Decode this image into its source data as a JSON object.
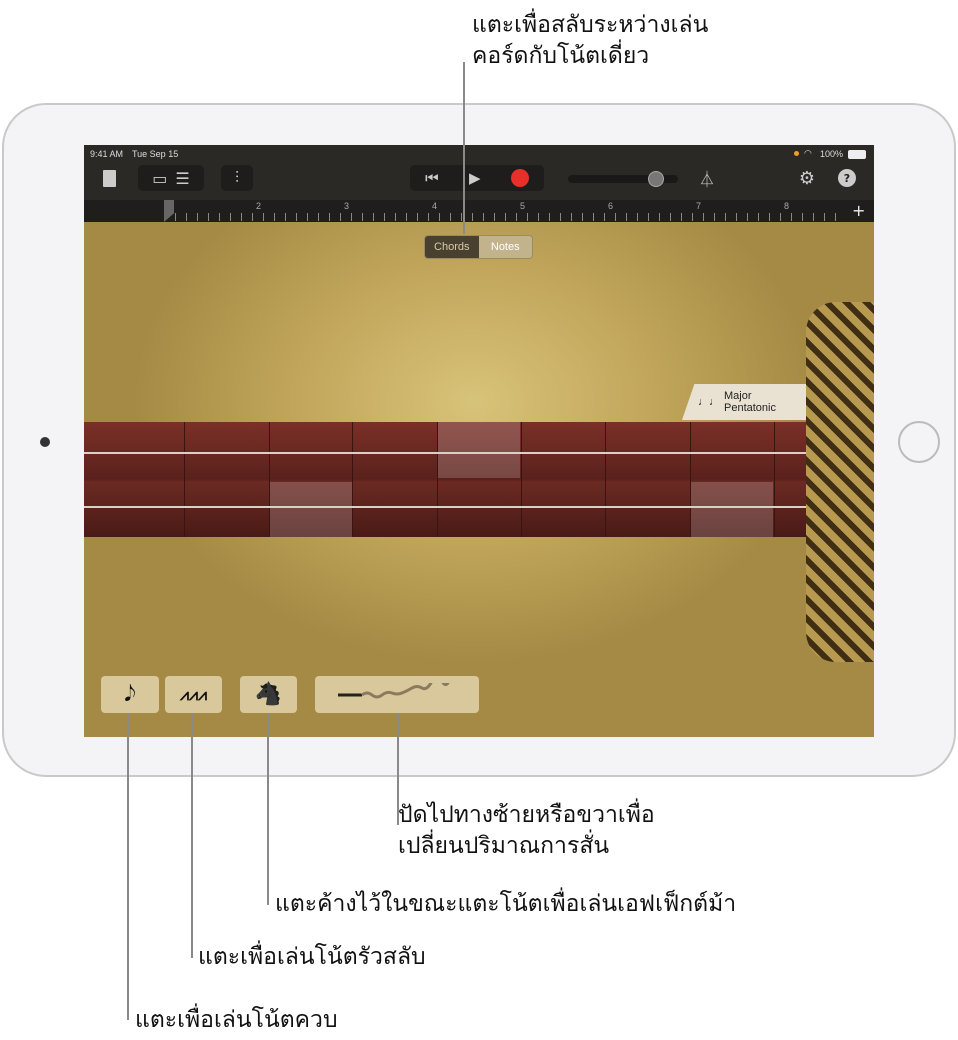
{
  "callouts": {
    "top": [
      "แตะเพื่อสลับระหว่างเล่น",
      "คอร์ดกับโน้ตเดี่ยว"
    ],
    "vibrato": [
      "ปัดไปทางซ้ายหรือขวาเพื่อ",
      "เปลี่ยนปริมาณการสั่น"
    ],
    "horse": "แตะค้างไว้ในขณะแตะโน้ตเพื่อเล่นเอฟเฟ็กต์ม้า",
    "tremolo": "แตะเพื่อเล่นโน้ตรัวสลับ",
    "double": "แตะเพื่อเล่นโน้ตควบ"
  },
  "status": {
    "time": "9:41 AM",
    "date": "Tue Sep 15",
    "battery": "100%"
  },
  "ruler": {
    "bars": [
      "1",
      "2",
      "3",
      "4",
      "5",
      "6",
      "7",
      "8"
    ],
    "add": "+"
  },
  "toggle": {
    "chords": "Chords",
    "notes": "Notes",
    "selected": "Notes"
  },
  "scale": {
    "icon": "♩♩",
    "label": "Major Pentatonic"
  },
  "controls": {
    "double_icon": "𝅘𝅥𝅮",
    "tremolo_icon": "⩘⩘⩘",
    "horse_icon": "🐴"
  },
  "colors": {
    "record": "#e8302a",
    "wood": "#c2a75c",
    "neck": "#6b2a23"
  }
}
